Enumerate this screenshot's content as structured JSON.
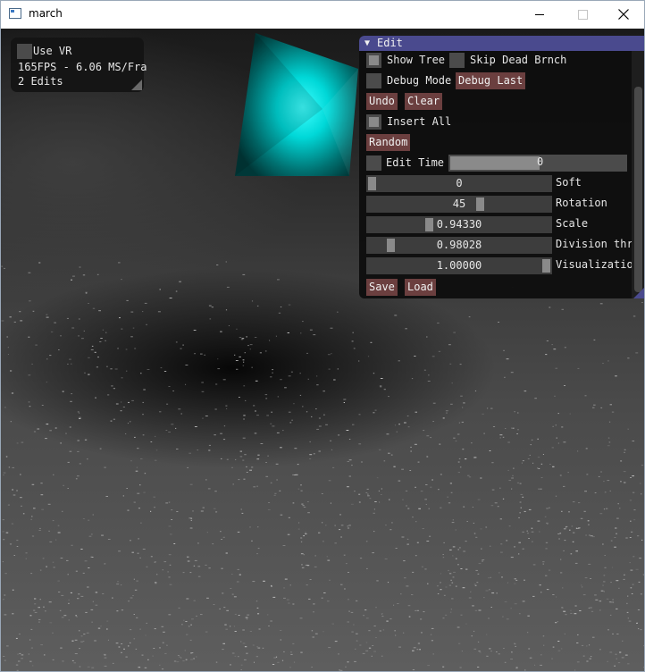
{
  "window": {
    "title": "march",
    "minimize_glyph": "—",
    "maximize_glyph": "☐",
    "close_glyph": "✕"
  },
  "overlay": {
    "use_vr_label": "Use VR",
    "use_vr_checked": false,
    "fps_text": "165FPS - 6.06 MS/Fra",
    "edits_text": "2 Edits"
  },
  "edit": {
    "title": "Edit",
    "show_tree_label": "Show Tree",
    "skip_dead_label": "Skip Dead Brnch",
    "debug_mode_label": "Debug Mode",
    "debug_last_label": "Debug Last",
    "undo_label": "Undo",
    "clear_label": "Clear",
    "insert_all_label": "Insert All",
    "random_label": "Random",
    "edit_time_label": "Edit Time",
    "edit_time_value": "0",
    "sliders": [
      {
        "value": "0",
        "label": "Soft",
        "fraction": 0.0
      },
      {
        "value": "45",
        "label": "Rotation",
        "fraction": 0.62
      },
      {
        "value": "0.94330",
        "label": "Scale",
        "fraction": 0.33
      },
      {
        "value": "0.98028",
        "label": "Division thr",
        "fraction": 0.11
      },
      {
        "value": "1.00000",
        "label": "Visualizatio",
        "fraction": 1.0
      }
    ],
    "save_label": "Save",
    "load_label": "Load"
  },
  "colors": {
    "imgui_title": "#4a4a8e",
    "imgui_button": "#6b3f3f",
    "imgui_frame": "#3d3d3d",
    "accent_cyan": "#00e6e6"
  }
}
